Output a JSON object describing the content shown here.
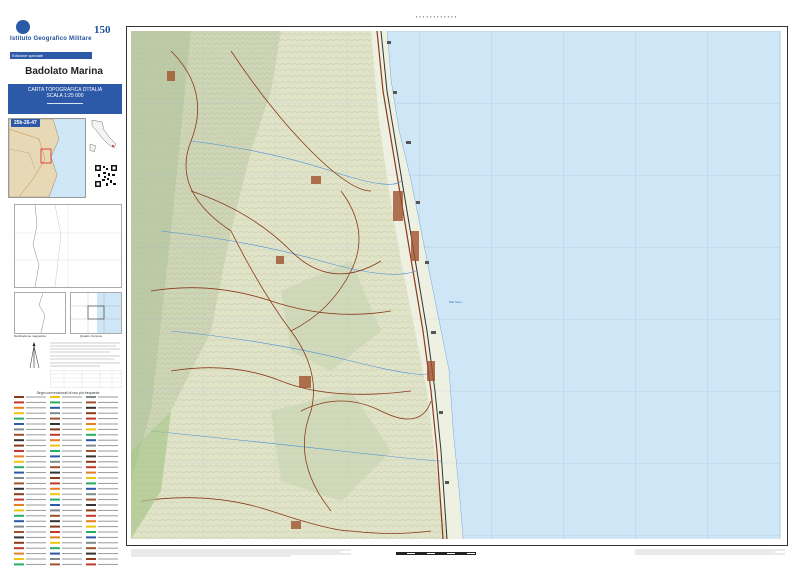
{
  "header": {
    "org_name": "Istituto Geografico Militare",
    "edition_label": "Edizione speciale",
    "badge": "150"
  },
  "sheet": {
    "name": "Badolato Marina",
    "series_line1": "CARTA TOPOGRAFICA D'ITALIA",
    "series_line2": "SCALA 1:25 000",
    "code": "25k-26-47"
  },
  "diagrams": {
    "declination_caption": "Declinazione magnetica",
    "sheet_grid_caption": "Quadro d'unione"
  },
  "legend": {
    "title": "Segni convenzionali di uso più frequente"
  },
  "map": {
    "sea_label": "Mar Ionio",
    "colors": {
      "sea": "#cfe6f6",
      "land": "#e6ead2",
      "relief": "#b9c8a6",
      "roads": "#8b3a1a",
      "frame": "#333333",
      "accent": "#2d5aa8"
    }
  }
}
